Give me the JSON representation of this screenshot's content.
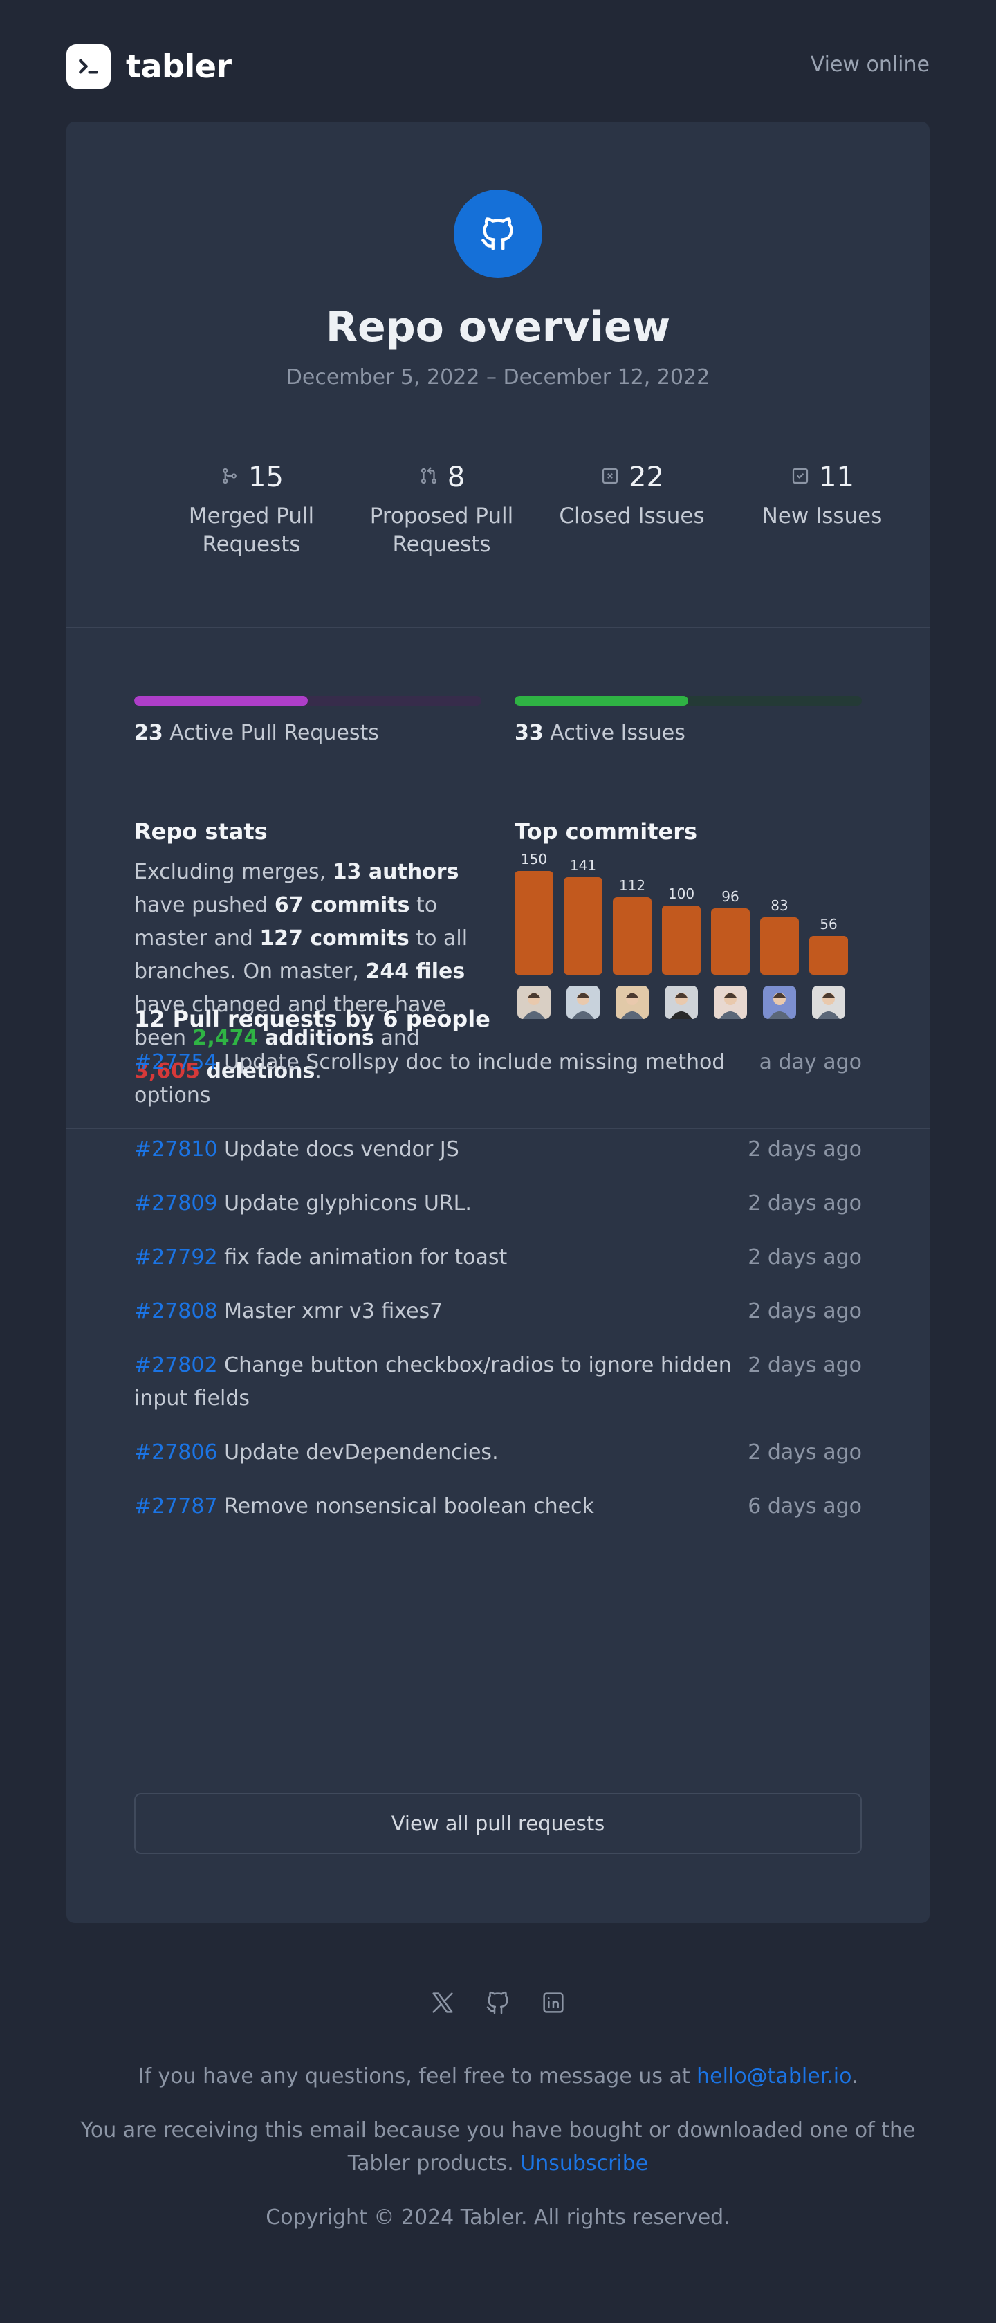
{
  "header": {
    "brand": "tabler",
    "view_online": "View online"
  },
  "hero": {
    "title": "Repo overview",
    "date_range": "December 5, 2022 – December 12, 2022"
  },
  "stats": [
    {
      "icon": "git-merge-icon",
      "value": "15",
      "label_line1": "Merged Pull",
      "label_line2": "Requests"
    },
    {
      "icon": "git-pull-request-icon",
      "value": "8",
      "label_line1": "Proposed Pull",
      "label_line2": "Requests"
    },
    {
      "icon": "square-x-icon",
      "value": "22",
      "label_line1": "Closed Issues",
      "label_line2": ""
    },
    {
      "icon": "square-check-icon",
      "value": "11",
      "label_line1": "New Issues",
      "label_line2": ""
    }
  ],
  "progress": {
    "pull_requests": {
      "count": "23",
      "label": "Active Pull Requests",
      "fraction": 0.5,
      "color": "#ae3ec9",
      "track": "#372c4b"
    },
    "issues": {
      "count": "33",
      "label": "Active Issues",
      "fraction": 0.5,
      "color": "#2fb344",
      "track": "#243a36"
    }
  },
  "repo_stats": {
    "title": "Repo stats",
    "t1": "Excluding merges, ",
    "b1": "13 authors",
    "t2": " have pushed ",
    "b2": "67 commits",
    "t3": " to master and ",
    "b3": "127 commits",
    "t4": " to all branches. On master, ",
    "b4": "244 files",
    "t5": " have changed and there have been ",
    "additions": "2,474",
    "b5": "additions",
    "t6": " and ",
    "deletions": "3,605",
    "b6": "deletions",
    "t7": "."
  },
  "top_commiters": {
    "title": "Top commiters",
    "bar_color": "#c2591e"
  },
  "chart_data": {
    "type": "bar",
    "categories": [
      "",
      "",
      "",
      "",
      "",
      "",
      ""
    ],
    "values": [
      150,
      141,
      112,
      100,
      96,
      83,
      56
    ],
    "title": "Top commiters",
    "xlabel": "",
    "ylabel": "",
    "ylim": [
      0,
      150
    ]
  },
  "pull_requests": {
    "title": "12 Pull requests by 6 people",
    "items": [
      {
        "id": "#27754",
        "title": "Update Scrollspy doc to include missing method options",
        "time": "a day ago"
      },
      {
        "id": "#27810",
        "title": "Update docs vendor JS",
        "time": "2 days ago"
      },
      {
        "id": "#27809",
        "title": "Update glyphicons URL.",
        "time": "2 days ago"
      },
      {
        "id": "#27792",
        "title": "fix fade animation for toast",
        "time": "2 days ago"
      },
      {
        "id": "#27808",
        "title": "Master xmr v3 fixes7",
        "time": "2 days ago"
      },
      {
        "id": "#27802",
        "title": "Change button checkbox/radios to ignore hidden input fields",
        "time": "2 days ago"
      },
      {
        "id": "#27806",
        "title": "Update devDependencies.",
        "time": "2 days ago"
      },
      {
        "id": "#27787",
        "title": "Remove nonsensical boolean check",
        "time": "6 days ago"
      }
    ],
    "view_all": "View all pull requests"
  },
  "footer": {
    "socials": [
      "x-icon",
      "github-icon",
      "linkedin-icon"
    ],
    "contact_text": "If you have any questions, feel free to message us at ",
    "contact_email": "hello@tabler.io",
    "contact_end": ".",
    "receiving_text": "You are receiving this email because you have bought or downloaded one of the Tabler products. ",
    "unsubscribe": "Unsubscribe",
    "copyright": "Copyright © 2024 Tabler. All rights reserved."
  }
}
